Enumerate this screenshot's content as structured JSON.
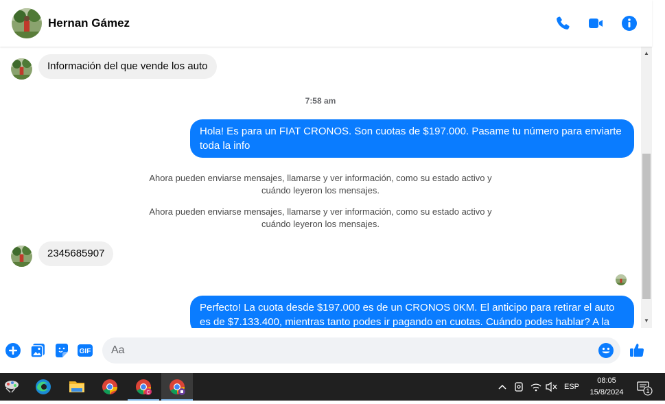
{
  "header": {
    "contact_name": "Hernan Gámez"
  },
  "messages": {
    "incoming_1": "Información del que vende los auto",
    "timestamp": "7:58 am",
    "outgoing_1": "Hola! Es para un FIAT CRONOS. Son cuotas de $197.000. Pasame tu número para enviarte toda la info",
    "system_1": "Ahora pueden enviarse mensajes, llamarse y ver información, como su estado activo y cuándo leyeron los mensajes.",
    "system_2": "Ahora pueden enviarse mensajes, llamarse y ver información, como su estado activo y cuándo leyeron los mensajes.",
    "incoming_2": "2345685907",
    "outgoing_2": "Perfecto! La cuota desde $197.000 es de un CRONOS 0KM. El anticipo para retirar el auto es de $7.133.400, mientras tanto podes ir pagando en cuotas. Cuándo podes hablar? A la"
  },
  "composer": {
    "placeholder": "Aa",
    "gif_label": "GIF"
  },
  "taskbar": {
    "language": "ESP",
    "time": "08:05",
    "date": "15/8/2024",
    "notification_count": "1"
  },
  "colors": {
    "accent": "#0a7cff",
    "incoming_bubble": "#f0f0f0",
    "taskbar": "#202020"
  }
}
